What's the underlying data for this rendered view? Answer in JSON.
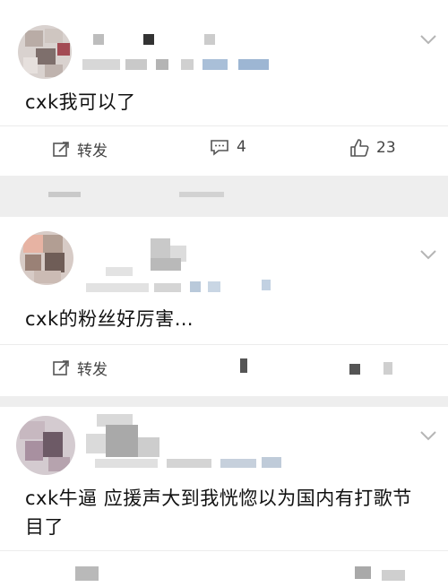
{
  "posts": [
    {
      "text": "cxk我可以了",
      "repost_label": "转发",
      "comment_count": "4",
      "like_count": "23"
    },
    {
      "text": "cxk的粉丝好厉害…",
      "repost_label": "转发"
    },
    {
      "text": "cxk牛逼 应援声大到我恍惚以为国内有打歌节目了"
    }
  ],
  "icons": {
    "repost": "repost-icon",
    "comment": "comment-icon",
    "like": "like-icon",
    "more": "chevron-down-icon"
  }
}
